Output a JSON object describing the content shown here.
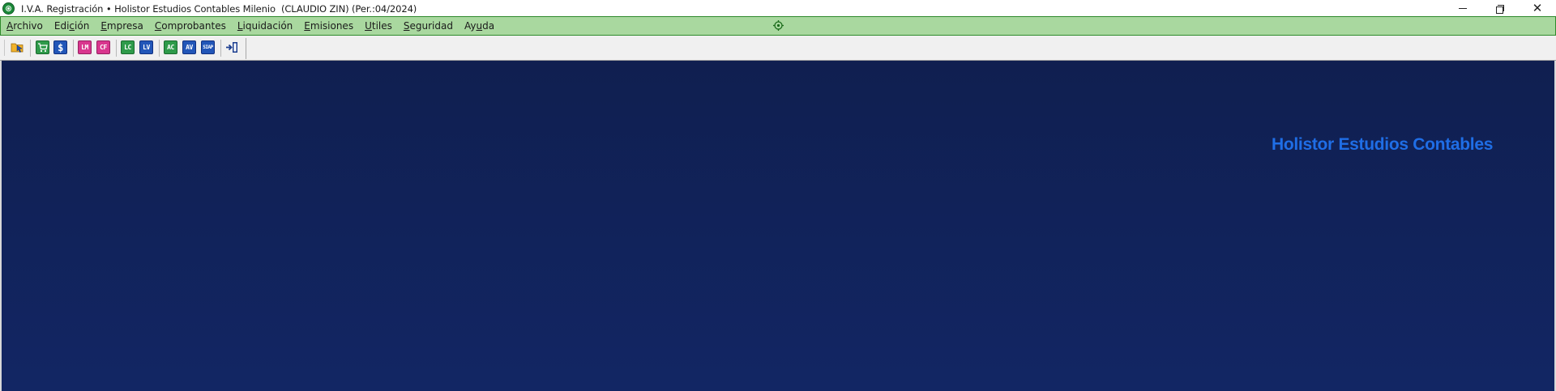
{
  "window": {
    "title": "I.V.A. Registración • Holistor Estudios Contables Milenio  (CLAUDIO ZIN) (Per.:04/2024)",
    "icon": "app-logo-icon",
    "controls": {
      "minimize_icon": "minimize-icon",
      "restore_icon": "restore-icon",
      "close_icon": "close-icon",
      "close_glyph": "✕"
    }
  },
  "menubar": {
    "background_color": "#a9d89f",
    "border_color": "#2f8a2c",
    "items": [
      {
        "pre": "",
        "u": "A",
        "post": "rchivo"
      },
      {
        "pre": "Edi",
        "u": "c",
        "post": "ión"
      },
      {
        "pre": "",
        "u": "E",
        "post": "mpresa"
      },
      {
        "pre": "",
        "u": "C",
        "post": "omprobantes"
      },
      {
        "pre": "",
        "u": "L",
        "post": "iquidación"
      },
      {
        "pre": "",
        "u": "E",
        "post": "misiones"
      },
      {
        "pre": "",
        "u": "U",
        "post": "tiles"
      },
      {
        "pre": "",
        "u": "S",
        "post": "eguridad"
      },
      {
        "pre": "Ay",
        "u": "u",
        "post": "da"
      }
    ],
    "center_icon": "target-icon"
  },
  "toolbar": {
    "buttons": [
      {
        "name": "open-company-icon",
        "label": "",
        "color": "#e8a21a"
      },
      {
        "name": "purchases-cart-icon",
        "label": "",
        "color": "#2e9a4a"
      },
      {
        "name": "sales-dollar-icon",
        "label": "$",
        "color": "#2256b8"
      },
      {
        "name": "lm-icon",
        "label": "LM",
        "color": "#d9368e"
      },
      {
        "name": "cf-icon",
        "label": "CF",
        "color": "#d9368e"
      },
      {
        "name": "lc-icon",
        "label": "LC",
        "color": "#2e9a4a"
      },
      {
        "name": "lv-icon",
        "label": "LV",
        "color": "#2256b8"
      },
      {
        "name": "ac-icon",
        "label": "AC",
        "color": "#2e9a4a"
      },
      {
        "name": "av-icon",
        "label": "AV",
        "color": "#2256b8"
      },
      {
        "name": "siap-icon",
        "label": "SIAP",
        "color": "#2256b8"
      },
      {
        "name": "exit-door-icon",
        "label": "",
        "color": "#1b3d8f"
      }
    ]
  },
  "main": {
    "brand_text": "Holistor Estudios Contables",
    "brand_color": "#1f6ee6",
    "background_top": "#101f50",
    "background_bottom": "#122664"
  }
}
